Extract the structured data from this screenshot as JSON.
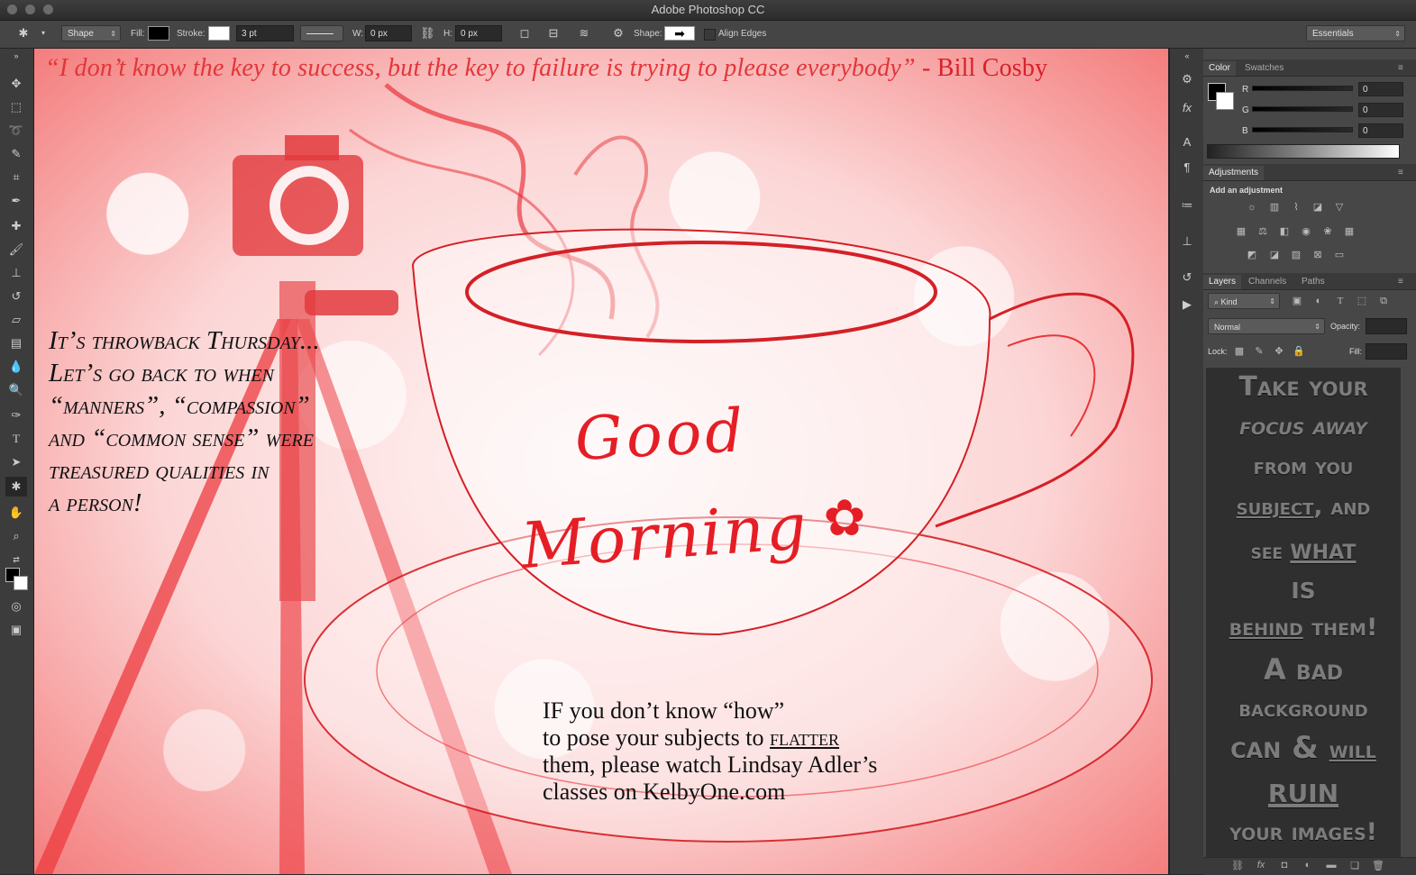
{
  "app": {
    "title": "Adobe Photoshop CC"
  },
  "options_bar": {
    "tool_mode": "Shape",
    "fill_label": "Fill:",
    "stroke_label": "Stroke:",
    "stroke_width": "3 pt",
    "w_label": "W:",
    "w_value": "0 px",
    "h_label": "H:",
    "h_value": "0 px",
    "shape_label": "Shape:",
    "align_edges": "Align Edges",
    "workspace": "Essentials"
  },
  "canvas": {
    "quote_text": "“I don’t know the key to success, but the key to failure is trying to please everybody”",
    "quote_author": " - Bill Cosby",
    "tbt_lines": [
      "It’s throwback Thursday...",
      "Let’s go back to when",
      "“manners”, “compassion”",
      "and “common sense” were",
      "treasured qualities in",
      "a person!"
    ],
    "good": "Good",
    "morning": "Morning",
    "ifyou_line1": "IF you don’t know “how”",
    "ifyou_line2_a": "to pose your subjects to ",
    "ifyou_line2_b": "flatter",
    "ifyou_line3": "them, please watch Lindsay Adler’s",
    "ifyou_line4": "classes on KelbyOne.com"
  },
  "panels": {
    "color_tab": "Color",
    "swatches_tab": "Swatches",
    "r_label": "R",
    "g_label": "G",
    "b_label": "B",
    "r_value": "0",
    "g_value": "0",
    "b_value": "0",
    "adjustments_tab": "Adjustments",
    "add_adjustment": "Add an adjustment",
    "layers_tab": "Layers",
    "channels_tab": "Channels",
    "paths_tab": "Paths",
    "kind": "Kind",
    "blend_mode": "Normal",
    "opacity_label": "Opacity:",
    "lock_label": "Lock:",
    "fill_label": "Fill:"
  },
  "side_text": {
    "l1": "Take your",
    "l2": "focus away",
    "l3": "from you",
    "l4a": "subject",
    "l4b": ", and",
    "l5a": "see ",
    "l5b": "what",
    "l6": "is",
    "l7a": "behind",
    "l7b": " them!",
    "l8": "A bad",
    "l9": "background",
    "l10a": "can & ",
    "l10b": "will",
    "l11": "ruin",
    "l12": "your images!"
  },
  "colors": {
    "accent_red": "#e51e25",
    "panel_bg": "#474747",
    "ui_dark": "#282828"
  }
}
